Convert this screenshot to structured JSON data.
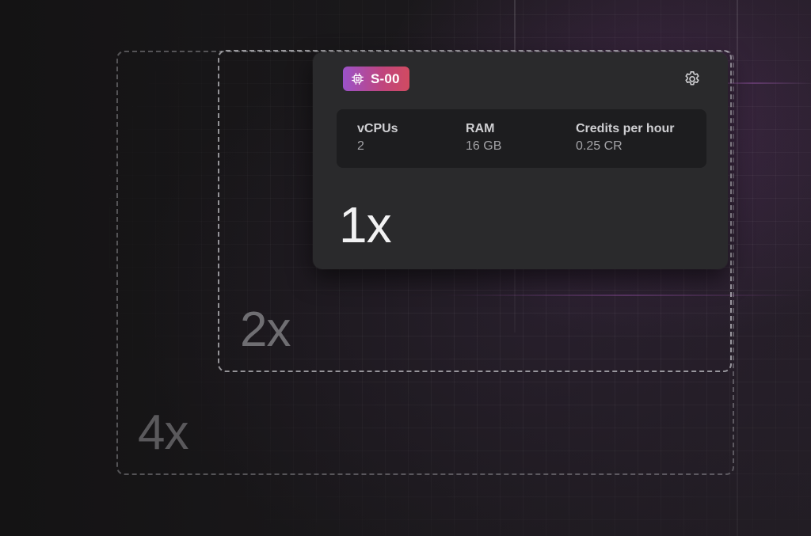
{
  "instance": {
    "badge_label": "S-00",
    "badge_icon": "cpu-chip-icon",
    "settings_icon": "gear-icon",
    "specs": {
      "vcpus_label": "vCPUs",
      "vcpus_value": "2",
      "ram_label": "RAM",
      "ram_value": "16 GB",
      "credits_label": "Credits per hour",
      "credits_value": "0.25 CR"
    },
    "multiplier": "1x"
  },
  "frames": {
    "second": "2x",
    "third": "4x"
  },
  "colors": {
    "badge_gradient_start": "#9b52c9",
    "badge_gradient_end": "#d14b61",
    "card_background": "#2a2a2c",
    "specs_background": "#1d1d1f"
  }
}
